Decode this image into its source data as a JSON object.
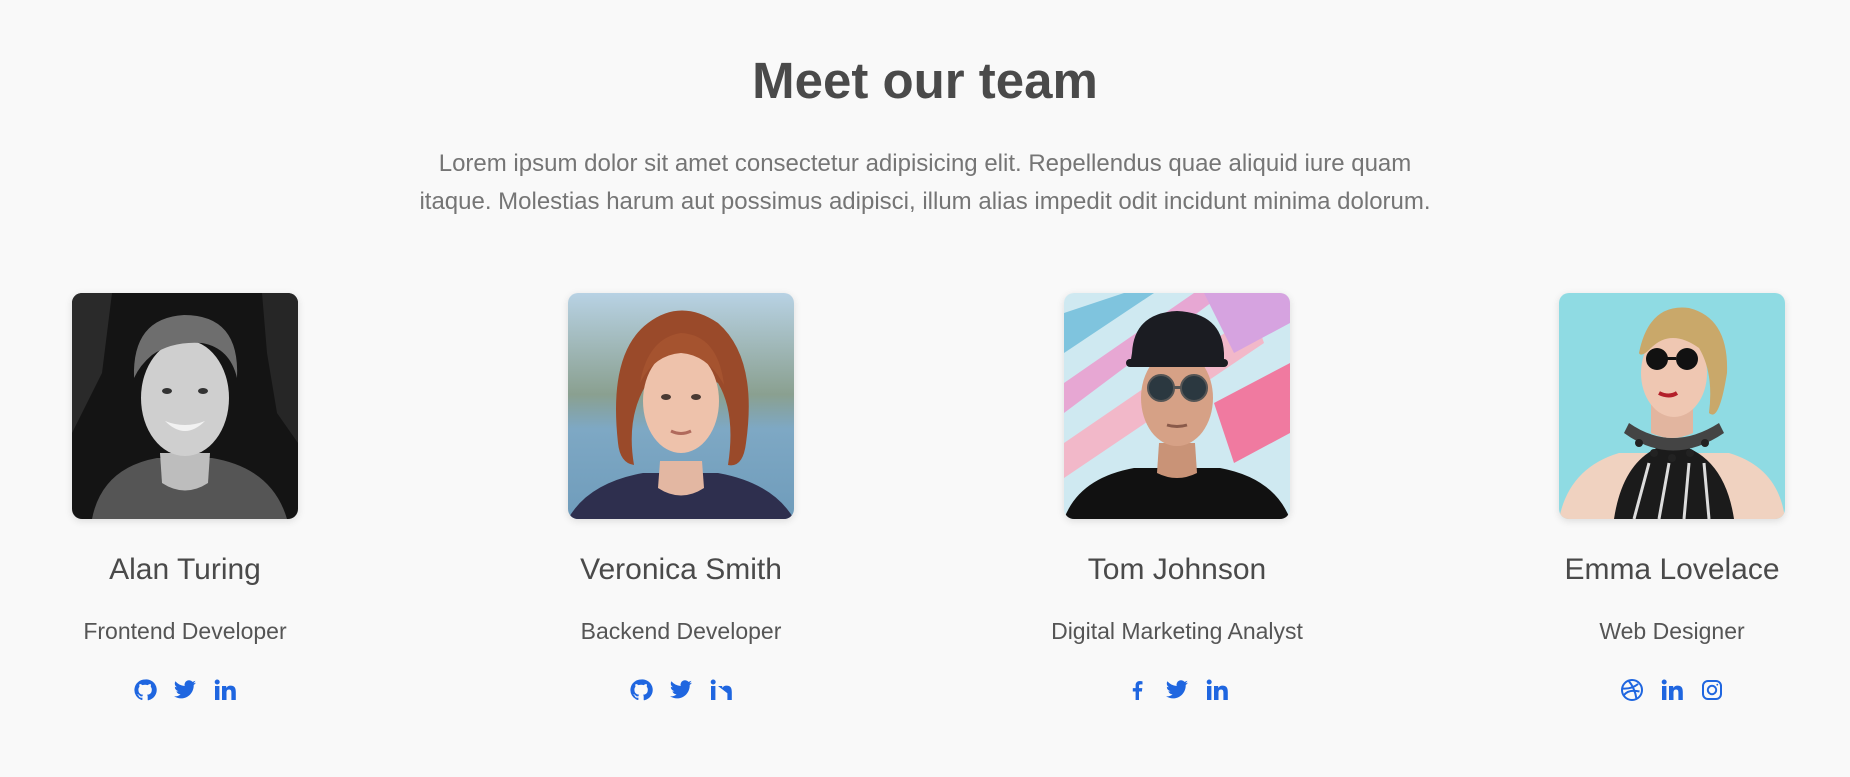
{
  "section": {
    "title": "Meet our team",
    "description": "Lorem ipsum dolor sit amet consectetur adipisicing elit. Repellendus quae aliquid iure quam itaque. Molestias harum aut possimus adipisci, illum alias impedit odit incidunt minima dolorum."
  },
  "colors": {
    "accent": "#1f66e0",
    "heading": "#4a4a4a",
    "text": "#757575",
    "background": "#f9f9f9"
  },
  "members": [
    {
      "name": "Alan Turing",
      "role": "Frontend Developer",
      "socials": [
        "github-icon",
        "twitter-icon",
        "linkedin-icon"
      ]
    },
    {
      "name": "Veronica Smith",
      "role": "Backend Developer",
      "socials": [
        "github-icon",
        "twitter-icon",
        "linkedin-icon"
      ]
    },
    {
      "name": "Tom Johnson",
      "role": "Digital Marketing Analyst",
      "socials": [
        "facebook-icon",
        "twitter-icon",
        "linkedin-icon"
      ]
    },
    {
      "name": "Emma Lovelace",
      "role": "Web Designer",
      "socials": [
        "dribbble-icon",
        "linkedin-icon",
        "instagram-icon"
      ]
    }
  ]
}
